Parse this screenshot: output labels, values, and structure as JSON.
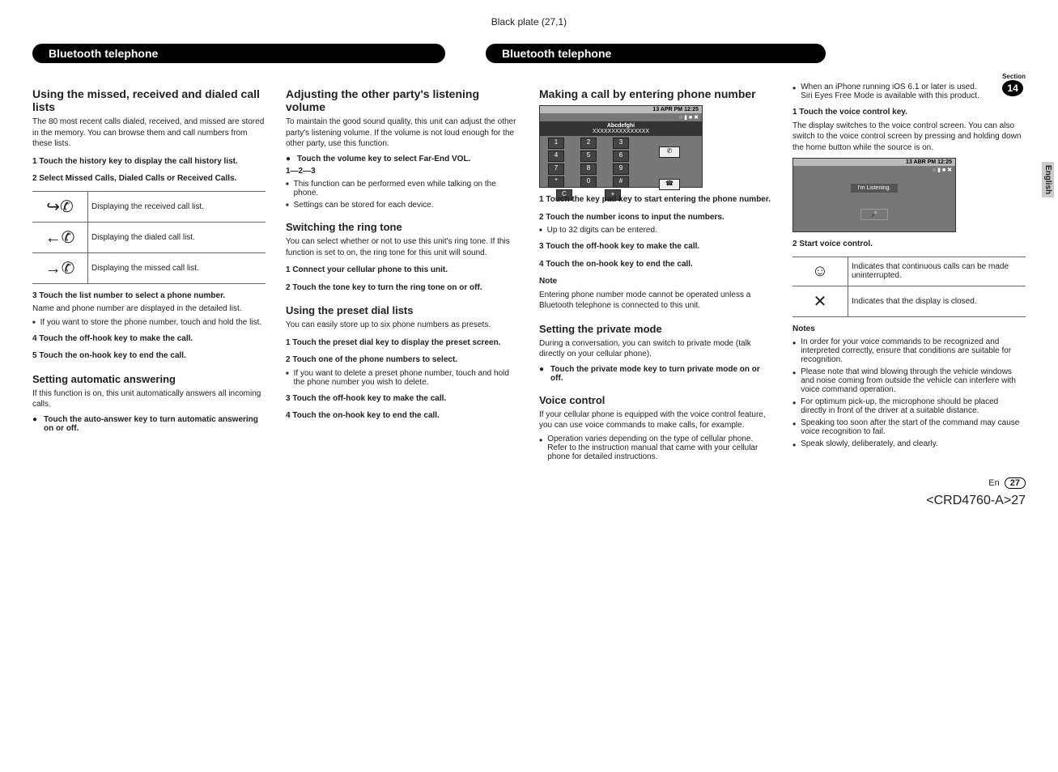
{
  "plate": "Black plate (27,1)",
  "header_left": "Bluetooth telephone",
  "header_right": "Bluetooth telephone",
  "section_label": "Section",
  "section_num": "14",
  "lang_tab": "English",
  "footer_lang": "En",
  "footer_page": "27",
  "doc_id": "<CRD4760-A>27",
  "col1": {
    "h1": "Using the missed, received and dialed call lists",
    "p1": "The 80 most recent calls dialed, received, and missed are stored in the memory. You can browse them and call numbers from these lists.",
    "s1": "1   Touch the history key to display the call history list.",
    "s2": "2   Select Missed Calls, Dialed Calls or Received Calls.",
    "table": [
      {
        "icon": "↪✆",
        "desc": "Displaying the received call list."
      },
      {
        "icon": "←✆",
        "desc": "Displaying the dialed call list."
      },
      {
        "icon": "→✆",
        "desc": "Displaying the missed call list."
      }
    ],
    "s3": "3   Touch the list number to select a phone number.",
    "p3": "Name and phone number are displayed in the detailed list.",
    "b3": "If you want to store the phone number, touch and hold the list.",
    "s4": "4   Touch the off-hook key to make the call.",
    "s5": "5   Touch the on-hook key to end the call.",
    "h2": "Setting automatic answering",
    "p2": "If this function is on, this unit automatically answers all incoming calls.",
    "sd1": "Touch the auto-answer key to turn automatic answering on or off."
  },
  "col2": {
    "h1": "Adjusting the other party's listening volume",
    "p1": "To maintain the good sound quality, this unit can adjust the other party's listening volume. If the volume is not loud enough for the other party, use this function.",
    "sd1": "Touch the volume key to select Far-End VOL.",
    "seq": "1—2—3",
    "b1": "This function can be performed even while talking on the phone.",
    "b2": "Settings can be stored for each device.",
    "h2": "Switching the ring tone",
    "p2": "You can select whether or not to use this unit's ring tone. If this function is set to on, the ring tone for this unit will sound.",
    "s1": "1   Connect your cellular phone to this unit.",
    "s2": "2   Touch the tone key to turn the ring tone on or off.",
    "h3": "Using the preset dial lists",
    "p3": "You can easily store up to six phone numbers as presets.",
    "s3": "1   Touch the preset dial key to display the preset screen.",
    "s4": "2   Touch one of the phone numbers to select.",
    "b3": "If you want to delete a preset phone number, touch and hold the phone number you wish to delete.",
    "s5": "3   Touch the off-hook key to make the call.",
    "s6": "4   Touch the on-hook key to end the call."
  },
  "col3": {
    "h1": "Making a call by entering phone number",
    "screen": {
      "date": "13 APR",
      "time": "12:25",
      "ampm": "PM",
      "name": "Abcdefghi",
      "num": "XXXXXXXXXXXXXXX",
      "keys": [
        [
          "1",
          "2",
          "3"
        ],
        [
          "4",
          "5",
          "6"
        ],
        [
          "7",
          "8",
          "9"
        ],
        [
          "*",
          "0",
          "#"
        ],
        [
          "C",
          "",
          "+"
        ]
      ]
    },
    "s1": "1   Touch the key pad key to start entering the phone number.",
    "s2": "2   Touch the number icons to input the numbers.",
    "b1": "Up to 32 digits can be entered.",
    "s3": "3   Touch the off-hook key to make the call.",
    "s4": "4   Touch the on-hook key to end the call.",
    "note_t": "Note",
    "note_p": "Entering phone number mode cannot be operated unless a Bluetooth telephone is connected to this unit.",
    "h2": "Setting the private mode",
    "p2": "During a conversation, you can switch to private mode (talk directly on your cellular phone).",
    "sd1": "Touch the private mode key to turn private mode on or off.",
    "h3": "Voice control",
    "p3": "If your cellular phone is equipped with the voice control feature, you can use voice commands to make calls, for example.",
    "d1": "Operation varies depending on the type of cellular phone. Refer to the instruction manual that came with your cellular phone for detailed instructions."
  },
  "col4": {
    "d1": "When an iPhone running iOS 6.1 or later is used.",
    "d1b": "Siri Eyes Free Mode is available with this product.",
    "s1": "1   Touch the voice control key.",
    "p1": "The display switches to the voice control screen. You can also switch to the voice control screen by pressing and holding down the home button while the source is on.",
    "screen": {
      "date": "13 ABR",
      "time": "12:25",
      "ampm": "PM",
      "msg": "I'm Listening."
    },
    "s2": "2   Start voice control.",
    "table": [
      {
        "icon": "☺",
        "desc": "Indicates that continuous calls can be made uninterrupted."
      },
      {
        "icon": "✕",
        "desc": "Indicates that the display is closed."
      }
    ],
    "notes_t": "Notes",
    "n1": "In order for your voice commands to be recognized and interpreted correctly, ensure that conditions are suitable for recognition.",
    "n2": "Please note that wind blowing through the vehicle windows and noise coming from outside the vehicle can interfere with voice command operation.",
    "n3": "For optimum pick-up, the microphone should be placed directly in front of the driver at a suitable distance.",
    "n4": "Speaking too soon after the start of the command may cause voice recognition to fail.",
    "n5": "Speak slowly, deliberately, and clearly."
  }
}
